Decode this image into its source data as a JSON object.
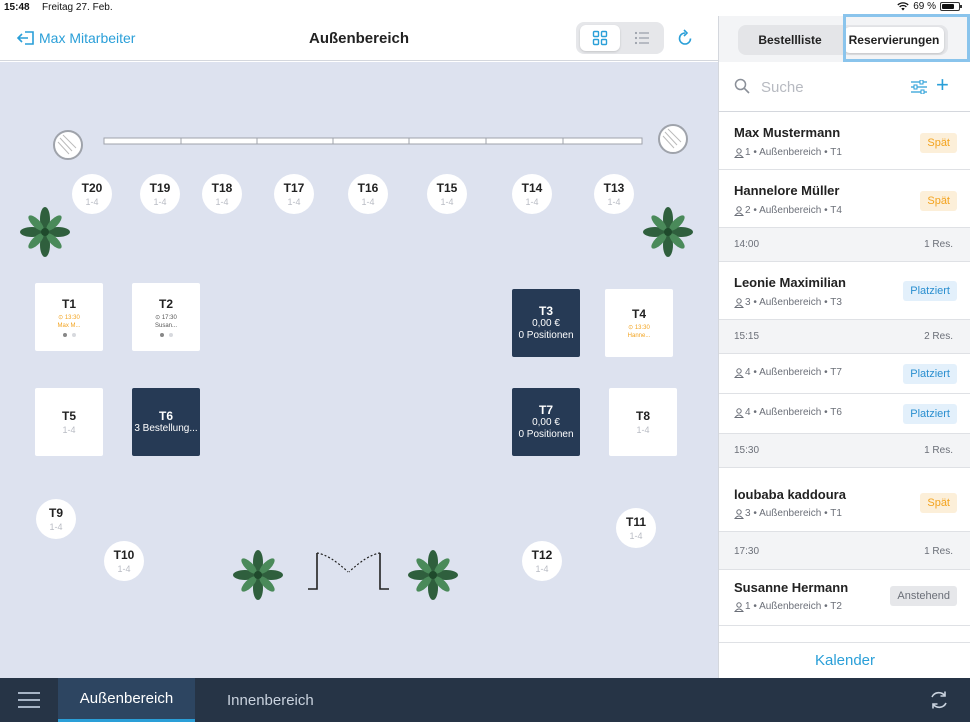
{
  "status": {
    "time": "15:48",
    "date": "Freitag 27. Feb.",
    "battery": "69 %"
  },
  "nav": {
    "back_label": "Max Mitarbeiter",
    "title": "Außenbereich"
  },
  "tables": {
    "t20": {
      "name": "T20",
      "cap": "1-4"
    },
    "t19": {
      "name": "T19",
      "cap": "1-4"
    },
    "t18": {
      "name": "T18",
      "cap": "1-4"
    },
    "t17": {
      "name": "T17",
      "cap": "1-4"
    },
    "t16": {
      "name": "T16",
      "cap": "1-4"
    },
    "t15": {
      "name": "T15",
      "cap": "1-4"
    },
    "t14": {
      "name": "T14",
      "cap": "1-4"
    },
    "t13": {
      "name": "T13",
      "cap": "1-4"
    },
    "t1": {
      "name": "T1",
      "time": "13:30",
      "guest": "Max M..."
    },
    "t2": {
      "name": "T2",
      "time": "17:30",
      "guest": "Susan..."
    },
    "t3": {
      "name": "T3",
      "amount": "0,00 €",
      "positions": "0 Positionen"
    },
    "t4": {
      "name": "T4",
      "time": "13:30",
      "guest": "Hanne..."
    },
    "t5": {
      "name": "T5",
      "cap": "1-4"
    },
    "t6": {
      "name": "T6",
      "orders": "3 Bestellung..."
    },
    "t7": {
      "name": "T7",
      "amount": "0,00 €",
      "positions": "0 Positionen"
    },
    "t8": {
      "name": "T8",
      "cap": "1-4"
    },
    "t9": {
      "name": "T9",
      "cap": "1-4"
    },
    "t10": {
      "name": "T10",
      "cap": "1-4"
    },
    "t11": {
      "name": "T11",
      "cap": "1-4"
    },
    "t12": {
      "name": "T12",
      "cap": "1-4"
    }
  },
  "right_panel": {
    "tabs": [
      "Bestellliste",
      "Reservierungen"
    ],
    "search_placeholder": "Suche",
    "rows": {
      "r1": {
        "name": "Max Mustermann",
        "meta": "1 • Außenbereich • T1",
        "badge": "Spät"
      },
      "r2": {
        "name": "Hannelore Müller",
        "meta": "2 • Außenbereich • T4",
        "badge": "Spät"
      },
      "g1": {
        "time": "14:00",
        "count": "1 Res."
      },
      "r3": {
        "name": "Leonie Maximilian",
        "meta": "3 • Außenbereich • T3",
        "badge": "Platziert"
      },
      "g2": {
        "time": "15:15",
        "count": "2 Res."
      },
      "r4": {
        "meta": "4 • Außenbereich • T7",
        "badge": "Platziert"
      },
      "r5": {
        "meta": "4 • Außenbereich • T6",
        "badge": "Platziert"
      },
      "g3": {
        "time": "15:30",
        "count": "1 Res."
      },
      "r6": {
        "name": "loubaba kaddoura",
        "meta": "3 • Außenbereich • T1",
        "badge": "Spät"
      },
      "g4": {
        "time": "17:30",
        "count": "1 Res."
      },
      "r7": {
        "name": "Susanne Hermann",
        "meta": "1 • Außenbereich • T2",
        "badge": "Anstehend"
      }
    },
    "calendar_label": "Kalender"
  },
  "bottom": {
    "tabs": [
      "Außenbereich",
      "Innenbereich"
    ]
  },
  "colors": {
    "accent": "#2a9fd8",
    "dark_table": "#263a55",
    "floor": "#dde2ef",
    "late": "#f3a31e",
    "bottom_bar": "#263446"
  }
}
